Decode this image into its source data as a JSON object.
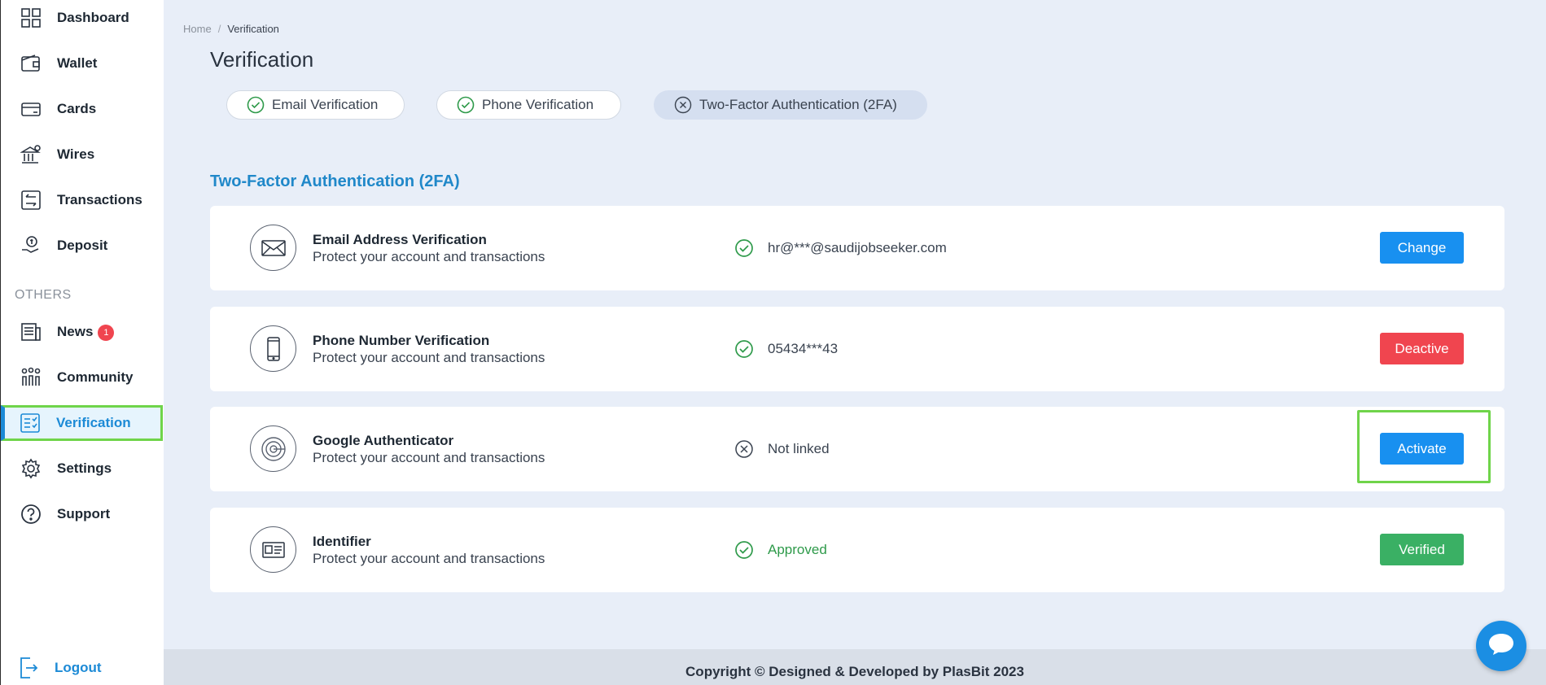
{
  "sidebar": {
    "items": [
      {
        "label": "Dashboard",
        "icon": "dashboard-icon"
      },
      {
        "label": "Wallet",
        "icon": "wallet-icon"
      },
      {
        "label": "Cards",
        "icon": "cards-icon"
      },
      {
        "label": "Wires",
        "icon": "bank-icon"
      },
      {
        "label": "Transactions",
        "icon": "transactions-icon"
      },
      {
        "label": "Deposit",
        "icon": "deposit-icon"
      }
    ],
    "others_label": "OTHERS",
    "others": [
      {
        "label": "News",
        "icon": "news-icon",
        "badge": "1"
      },
      {
        "label": "Community",
        "icon": "community-icon"
      },
      {
        "label": "Verification",
        "icon": "verification-icon",
        "active": true
      },
      {
        "label": "Settings",
        "icon": "gear-icon"
      },
      {
        "label": "Support",
        "icon": "help-icon"
      }
    ],
    "logout_label": "Logout"
  },
  "breadcrumb": {
    "home": "Home",
    "separator": "/",
    "current": "Verification"
  },
  "page_title": "Verification",
  "tabs": [
    {
      "label": "Email Verification",
      "state": "verified"
    },
    {
      "label": "Phone Verification",
      "state": "verified"
    },
    {
      "label": "Two-Factor Authentication (2FA)",
      "state": "not-verified",
      "selected": true
    }
  ],
  "section_heading": "Two-Factor Authentication (2FA)",
  "cards": [
    {
      "title": "Email Address Verification",
      "desc": "Protect your account and transactions",
      "status": "hr@***@saudijobseeker.com",
      "status_state": "ok",
      "action": "Change",
      "action_color": "#1890f0",
      "icon": "envelope-icon"
    },
    {
      "title": "Phone Number Verification",
      "desc": "Protect your account and transactions",
      "status": "05434***43",
      "status_state": "ok",
      "action": "Deactive",
      "action_color": "#f0454f",
      "icon": "phone-icon"
    },
    {
      "title": "Google Authenticator",
      "desc": "Protect your account and transactions",
      "status": "Not linked",
      "status_state": "none",
      "action": "Activate",
      "action_color": "#1890f0",
      "icon": "authenticator-icon"
    },
    {
      "title": "Identifier",
      "desc": "Protect your account and transactions",
      "status": "Approved",
      "status_state": "approved",
      "action": "Verified",
      "action_color": "#3ab064",
      "icon": "id-card-icon"
    }
  ],
  "footer": {
    "text": "Copyright © Designed & Developed by PlasBit 2023"
  },
  "colors": {
    "accent": "#1c8ad6",
    "highlight": "#6fd44a",
    "success": "#2e9a4a",
    "danger": "#f0454f"
  }
}
